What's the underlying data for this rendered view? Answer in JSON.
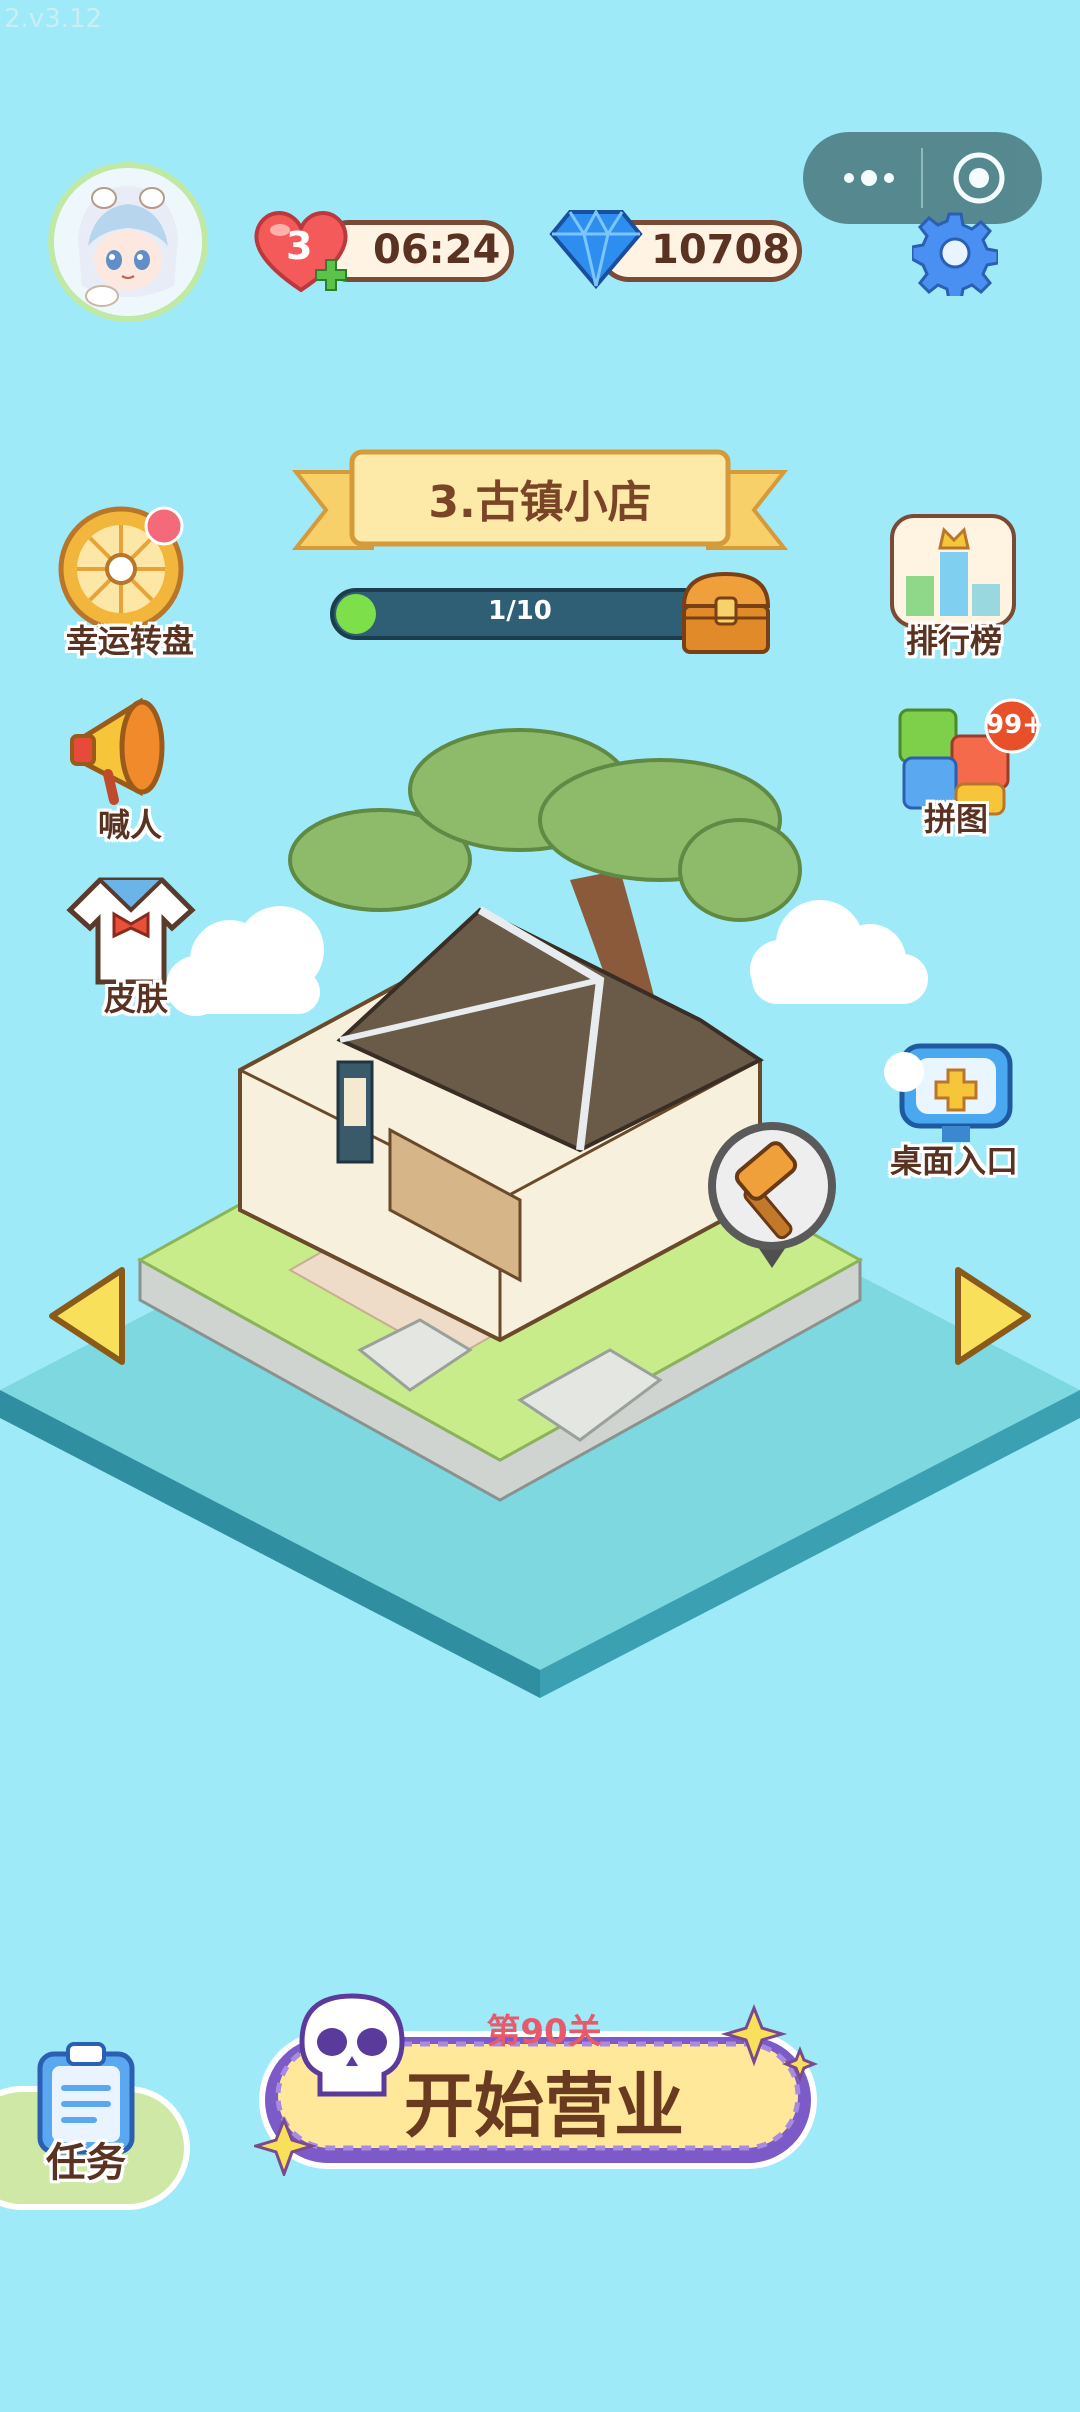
{
  "version": "2.v3.12",
  "hud": {
    "lives": "3",
    "timer": "06:24",
    "gems": "10708"
  },
  "level_banner": {
    "title": "3.古镇小店",
    "progress_text": "1/10",
    "progress": 0.1
  },
  "left_menu": [
    {
      "label": "幸运转盘"
    },
    {
      "label": "喊人"
    },
    {
      "label": "皮肤"
    }
  ],
  "right_menu": [
    {
      "label": "排行榜"
    },
    {
      "label": "拼图",
      "badge": "99+"
    },
    {
      "label": "桌面入口"
    }
  ],
  "task_button": {
    "label": "任务"
  },
  "start_button": {
    "level": "第90关",
    "label": "开始营业"
  },
  "colors": {
    "background": "#9eeaf8",
    "text_brown": "#5a3222",
    "progress_green": "#7de04a",
    "start_purple": "#7c5ac8",
    "start_yellow": "#ffe89a"
  }
}
